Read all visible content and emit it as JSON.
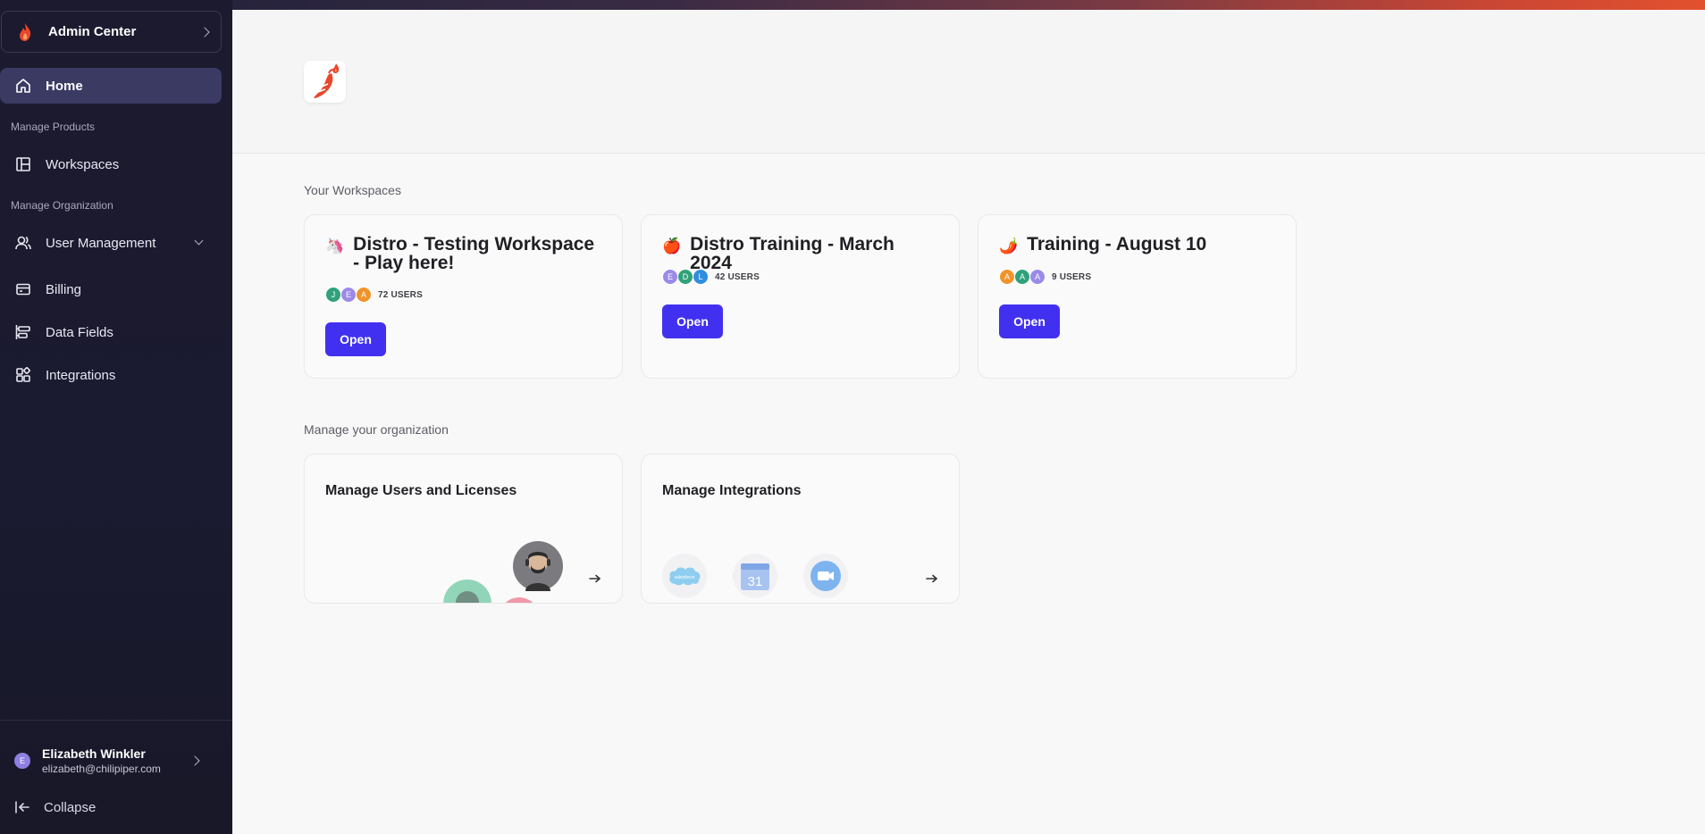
{
  "sidebar": {
    "org_label": "Admin Center",
    "home_label": "Home",
    "section_products": "Manage Products",
    "workspaces_label": "Workspaces",
    "section_org": "Manage Organization",
    "user_management_label": "User Management",
    "billing_label": "Billing",
    "data_fields_label": "Data Fields",
    "integrations_label": "Integrations",
    "user": {
      "initial": "E",
      "name": "Elizabeth Winkler",
      "email": "elizabeth@chilipiper.com"
    },
    "collapse_label": "Collapse"
  },
  "main": {
    "workspaces_section_title": "Your Workspaces",
    "workspaces": [
      {
        "emoji": "🦄",
        "title": "Distro - Testing Workspace - Play here!",
        "avatars": [
          {
            "initial": "J",
            "color": "#2fa27a"
          },
          {
            "initial": "E",
            "color": "#9c8ae8"
          },
          {
            "initial": "A",
            "color": "#f0932b"
          }
        ],
        "user_count": "72 USERS",
        "button": "Open"
      },
      {
        "emoji": "🍎",
        "title": "Distro Training - March 2024",
        "avatars": [
          {
            "initial": "E",
            "color": "#9c8ae8"
          },
          {
            "initial": "D",
            "color": "#2fa27a"
          },
          {
            "initial": "L",
            "color": "#2f8ee0"
          }
        ],
        "user_count": "42 USERS",
        "button": "Open"
      },
      {
        "emoji": "🌶️",
        "title": "Training - August 10",
        "avatars": [
          {
            "initial": "A",
            "color": "#f0932b"
          },
          {
            "initial": "A",
            "color": "#2fa27a"
          },
          {
            "initial": "A",
            "color": "#9c8ae8"
          }
        ],
        "user_count": "9 USERS",
        "button": "Open"
      }
    ],
    "org_section_title": "Manage your organization",
    "manage_users_title": "Manage Users and Licenses",
    "manage_integrations_title": "Manage Integrations",
    "integration_icons": [
      "salesforce-icon",
      "google-calendar-icon",
      "zoom-icon"
    ],
    "calendar_day": "31",
    "salesforce_text": "salesforce"
  },
  "colors": {
    "accent": "#4230f0",
    "sidebar_bg": "#1c1a2e",
    "active_nav": "#3b3a63",
    "brand": "#e2512e"
  }
}
